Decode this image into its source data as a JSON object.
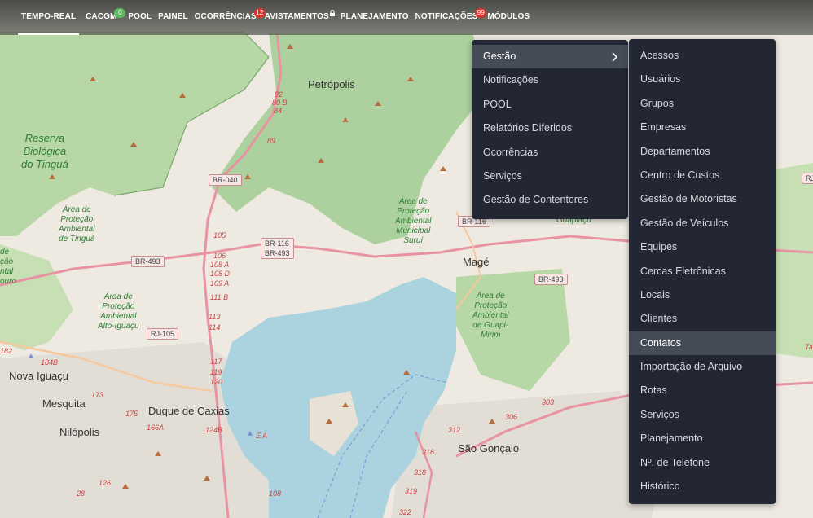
{
  "nav": {
    "items": [
      {
        "label": "TEMPO-REAL",
        "active": true
      },
      {
        "label": "CACGM",
        "badge": "0",
        "badge_color": "#5cb85c"
      },
      {
        "label": "POOL"
      },
      {
        "label": "PAINEL"
      },
      {
        "label": "OCORRÊNCIAS",
        "badge": "12",
        "badge_color": "#d9342b"
      },
      {
        "label": "AVISTAMENTOS",
        "icon": "lock-icon"
      },
      {
        "label": "PLANEJAMENTO"
      },
      {
        "label": "NOTIFICAÇÕES",
        "badge": "99",
        "badge_color": "#d9342b"
      },
      {
        "label": "MÓDULOS"
      }
    ]
  },
  "menu_left": {
    "items": [
      "Gestão",
      "Notificações",
      "POOL",
      "Relatórios Diferidos",
      "Ocorrências",
      "Serviços",
      "Gestão de Contentores"
    ],
    "highlighted": "Gestão",
    "submenu_icon": "chevron-right-icon"
  },
  "menu_right": {
    "items": [
      "Acessos",
      "Usuários",
      "Grupos",
      "Empresas",
      "Departamentos",
      "Centro de Custos",
      "Gestão de Motoristas",
      "Gestão de Veículos",
      "Equipes",
      "Cercas Eletrônicas",
      "Locais",
      "Clientes",
      "Contatos",
      "Importação de Arquivo",
      "Rotas",
      "Serviços",
      "Planejamento",
      "Nº. de Telefone",
      "Histórico"
    ],
    "highlighted": "Contatos"
  },
  "map": {
    "cities": {
      "petropolis": "Petrópolis",
      "mage": "Magé",
      "nova_iguacu": "Nova Iguaçu",
      "mesquita": "Mesquita",
      "duque_de_caxias": "Duque de Caxias",
      "nilopolis": "Nilópolis",
      "sao_goncalo": "São Gonçalo",
      "guapiacu": "Guapiaçu"
    },
    "parks": {
      "tingua": "Reserva\nBiológica\ndo Tinguá",
      "apa_tingua": "Área de\nProteção\nAmbiental\nde Tinguá",
      "apa_surui": "Área de\nProteção\nAmbiental\nMunicipal\nSuruí",
      "apa_alto_iguacu": "Área de\nProteção\nAmbiental\nAlto-Iguaçu",
      "apa_guapimirim": "Área de\nProteção\nAmbiental\nde Guapi-\nMirim",
      "left_cut": "de\nção\nntal\nouro"
    },
    "roads": {
      "br040": "BR-040",
      "br116_493": "BR-116\nBR-493",
      "br493_a": "BR-493",
      "br116_b": "BR-116",
      "br493_b": "BR-493",
      "rj105": "RJ-105",
      "rj_right": "RJ"
    },
    "km_markers": [
      "82",
      "80 B",
      "84",
      "89",
      "105",
      "106",
      "108 A",
      "108 D",
      "109 A",
      "111 B",
      "113",
      "114",
      "117",
      "119",
      "120",
      "173",
      "175",
      "166A",
      "124B",
      "182",
      "184B",
      "312",
      "316",
      "318",
      "319",
      "306",
      "303",
      "108",
      "322",
      "E A",
      "126",
      "28",
      "Ta"
    ]
  },
  "colors": {
    "menu_bg": "#222733",
    "menu_highlight": "#454c57",
    "forest": "#add19e",
    "water": "#aad3df",
    "land": "#eeeae2"
  }
}
